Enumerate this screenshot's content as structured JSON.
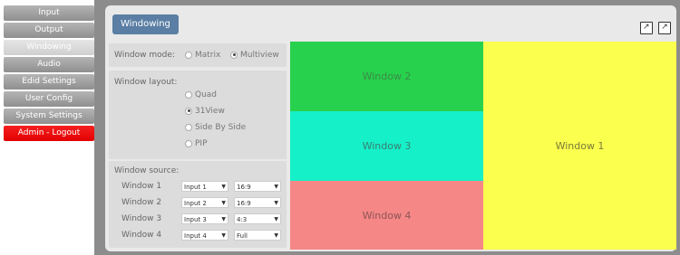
{
  "nav": {
    "items": [
      {
        "label": "Input"
      },
      {
        "label": "Output"
      },
      {
        "label": "Windowing"
      },
      {
        "label": "Audio"
      },
      {
        "label": "Edid Settings"
      },
      {
        "label": "User Config"
      },
      {
        "label": "System Settings"
      },
      {
        "label": "Admin - Logout"
      }
    ],
    "active": "Windowing"
  },
  "header": {
    "tab_label": "Windowing",
    "icons": [
      "export-icon",
      "export-icon"
    ]
  },
  "mode": {
    "label": "Window mode:",
    "options": [
      {
        "label": "Matrix",
        "selected": false
      },
      {
        "label": "Multiview",
        "selected": true
      }
    ]
  },
  "layout": {
    "label": "Window layout:",
    "options": [
      {
        "label": "Quad",
        "selected": false
      },
      {
        "label": "31View",
        "selected": true
      },
      {
        "label": "Side By Side",
        "selected": false
      },
      {
        "label": "PIP",
        "selected": false
      }
    ]
  },
  "source": {
    "label": "Window source:",
    "rows": [
      {
        "name": "Window 1",
        "input": "Input 1",
        "ratio": "16:9"
      },
      {
        "name": "Window 2",
        "input": "Input 2",
        "ratio": "16:9"
      },
      {
        "name": "Window 3",
        "input": "Input 3",
        "ratio": "4:3"
      },
      {
        "name": "Window 4",
        "input": "Input 4",
        "ratio": "Full"
      }
    ]
  },
  "preview": {
    "windows": [
      {
        "label": "Window 2",
        "color": "#27d14d",
        "text_color": "#3c8a47"
      },
      {
        "label": "Window 3",
        "color": "#16f0c9",
        "text_color": "#3a7f72"
      },
      {
        "label": "Window 4",
        "color": "#f58787",
        "text_color": "#8f5656"
      },
      {
        "label": "Window 1",
        "color": "#fbff4d",
        "text_color": "#7a7a3a"
      }
    ]
  },
  "colors": {
    "accent": "#5b7ea4",
    "logout": "#e60000"
  }
}
